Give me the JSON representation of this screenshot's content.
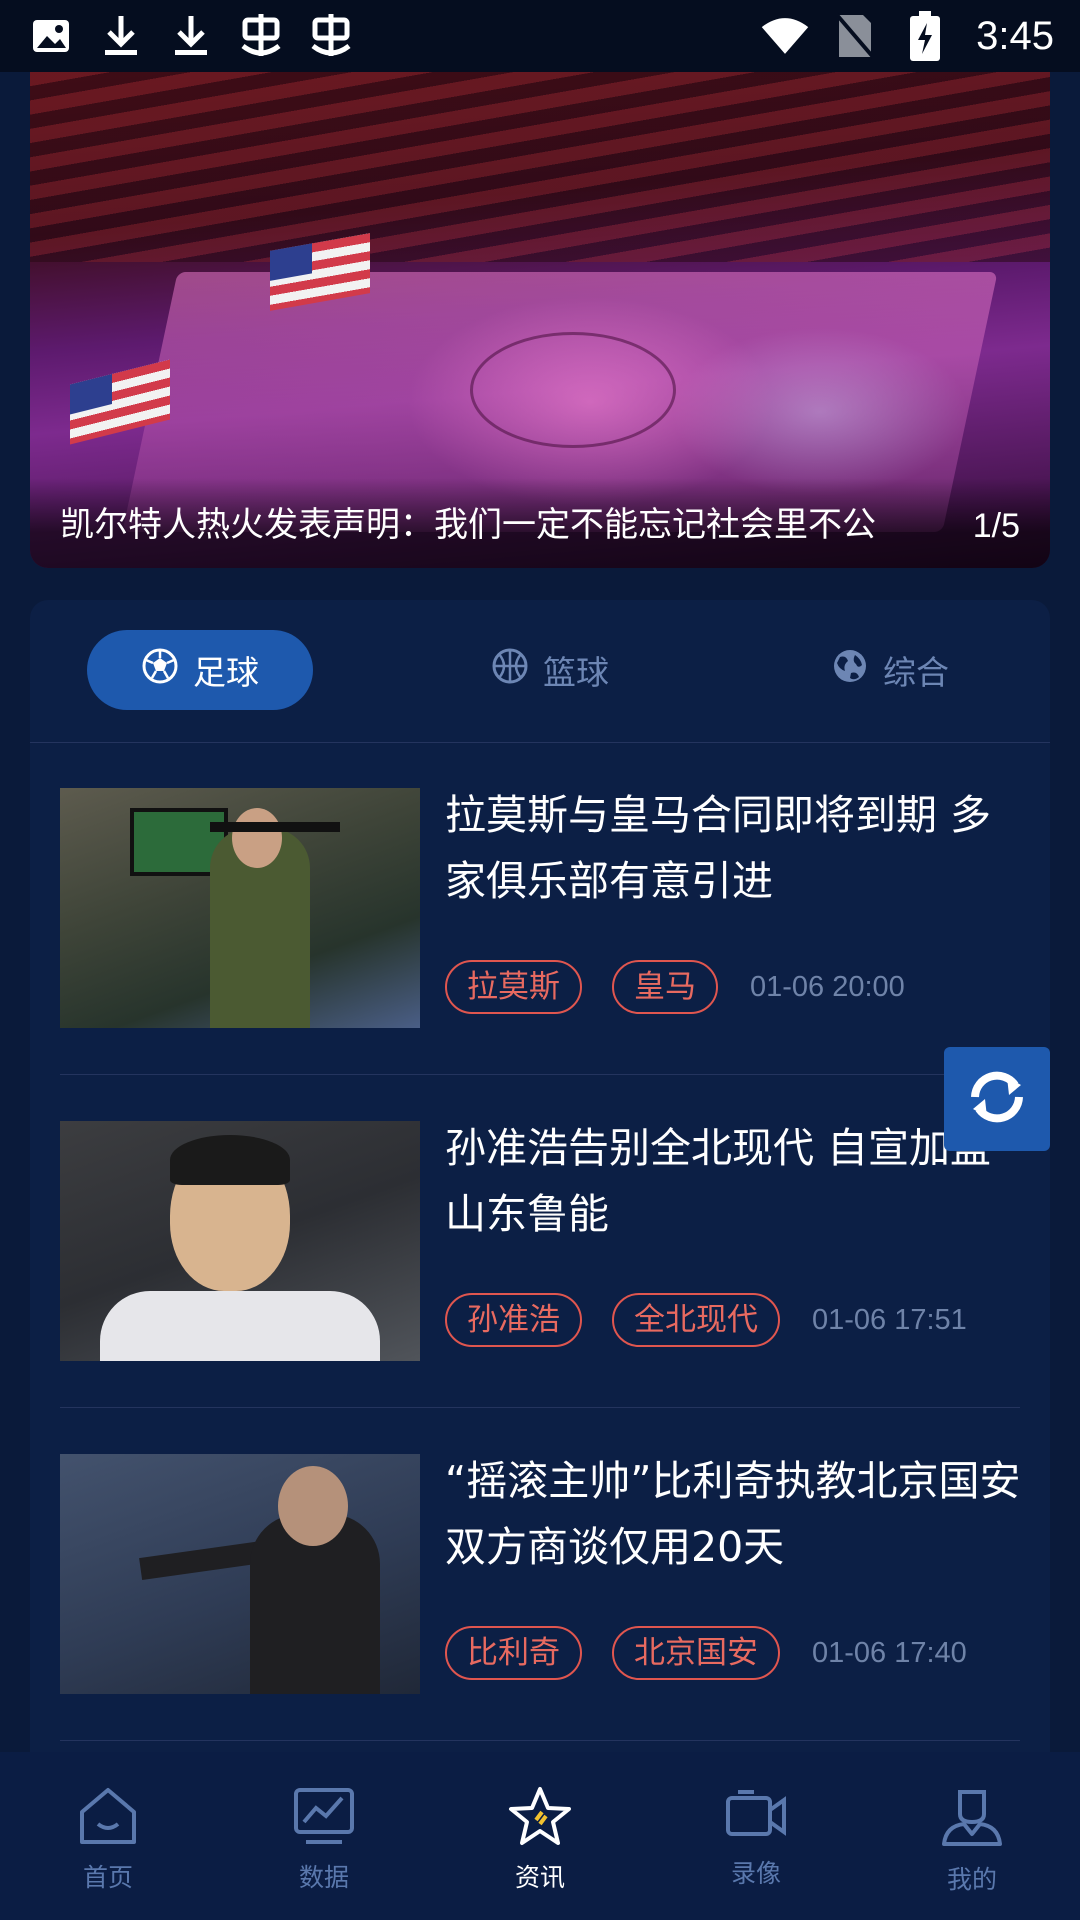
{
  "status_bar": {
    "time": "3:45",
    "left_icons": [
      "image-icon",
      "download-icon",
      "download-icon",
      "bug-icon",
      "bug-icon"
    ],
    "right_icons": [
      "wifi-icon",
      "no-sim-icon",
      "battery-charging-icon"
    ]
  },
  "banner": {
    "caption": "凯尔特人热火发表声明：我们一定不能忘记社会里不公",
    "index": "1/5"
  },
  "tabs": [
    {
      "label": "足球",
      "icon": "soccer-ball-icon",
      "active": true
    },
    {
      "label": "篮球",
      "icon": "basketball-icon",
      "active": false
    },
    {
      "label": "综合",
      "icon": "globe-icon",
      "active": false
    }
  ],
  "articles": [
    {
      "title": "拉莫斯与皇马合同即将到期 多家俱乐部有意引进",
      "tags": [
        "拉莫斯",
        "皇马"
      ],
      "time": "01-06 20:00"
    },
    {
      "title": "孙准浩告别全北现代 自宣加盟山东鲁能",
      "tags": [
        "孙准浩",
        "全北现代"
      ],
      "time": "01-06 17:51"
    },
    {
      "title": "“摇滚主帅”比利奇执教北京国安 双方商谈仅用20天",
      "tags": [
        "比利奇",
        "北京国安"
      ],
      "time": "01-06 17:40"
    }
  ],
  "bottom_nav": [
    {
      "label": "首页",
      "icon": "home-icon",
      "active": false
    },
    {
      "label": "数据",
      "icon": "chart-icon",
      "active": false
    },
    {
      "label": "资讯",
      "icon": "star-icon",
      "active": true
    },
    {
      "label": "录像",
      "icon": "video-camera-icon",
      "active": false
    },
    {
      "label": "我的",
      "icon": "user-icon",
      "active": false
    }
  ],
  "colors": {
    "background": "#0a1a3a",
    "card": "#0c1f45",
    "accent": "#1e59ad",
    "tag": "#e0564f",
    "muted": "#6f83a8"
  }
}
